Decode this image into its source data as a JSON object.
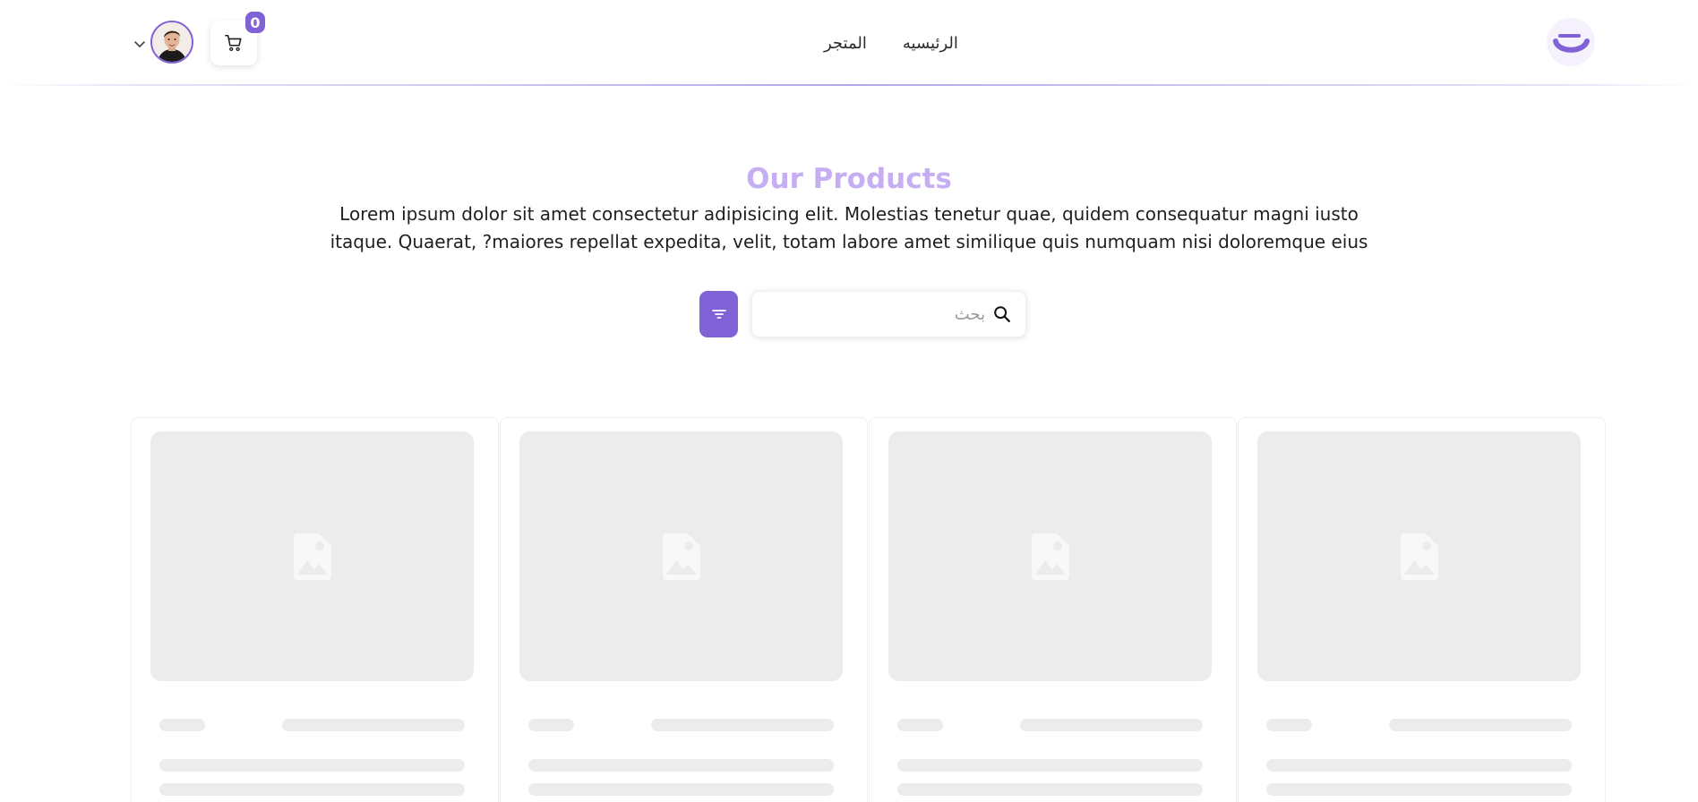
{
  "header": {
    "nav": [
      {
        "label": "الرئيسيه"
      },
      {
        "label": "المتجر"
      }
    ],
    "cart_count": "0",
    "icons": {
      "logo": "logo-icon",
      "cart": "cart-icon",
      "dropdown": "chevron-down-icon",
      "avatar": "avatar"
    }
  },
  "hero": {
    "title": "Our Products",
    "description": "Lorem ipsum dolor sit amet consectetur adipisicing elit. Molestias tenetur quae, quidem consequatur magni iusto itaque. Quaerat, ?maiores repellat expedita, velit, totam labore amet similique quis numquam nisi doloremque eius"
  },
  "search": {
    "placeholder": "بحث",
    "value": ""
  },
  "products": {
    "state": "loading",
    "skeleton_cards": 4
  },
  "colors": {
    "accent": "#8062d6",
    "title": "#c6aef2",
    "skeleton": "#ececec"
  }
}
